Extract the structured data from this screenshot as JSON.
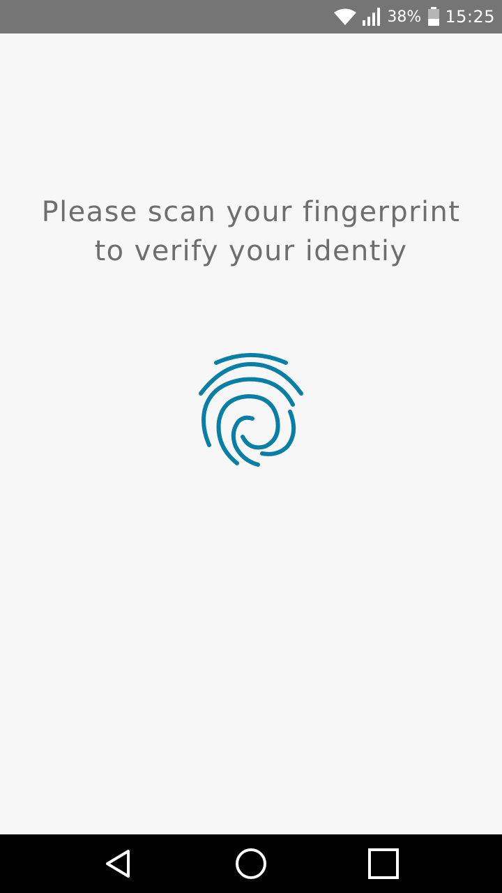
{
  "status_bar": {
    "battery_percent": "38%",
    "time": "15:25",
    "icons": [
      "wifi-icon",
      "signal-icon",
      "battery-icon"
    ]
  },
  "main": {
    "message_line1": "Please scan your fingerprint",
    "message_line2": "to verify your identiy",
    "fingerprint_icon": "fingerprint-icon",
    "accent_color": "#0a7fa6"
  },
  "nav_bar": {
    "buttons": [
      "back-icon",
      "home-icon",
      "recent-apps-icon"
    ]
  }
}
